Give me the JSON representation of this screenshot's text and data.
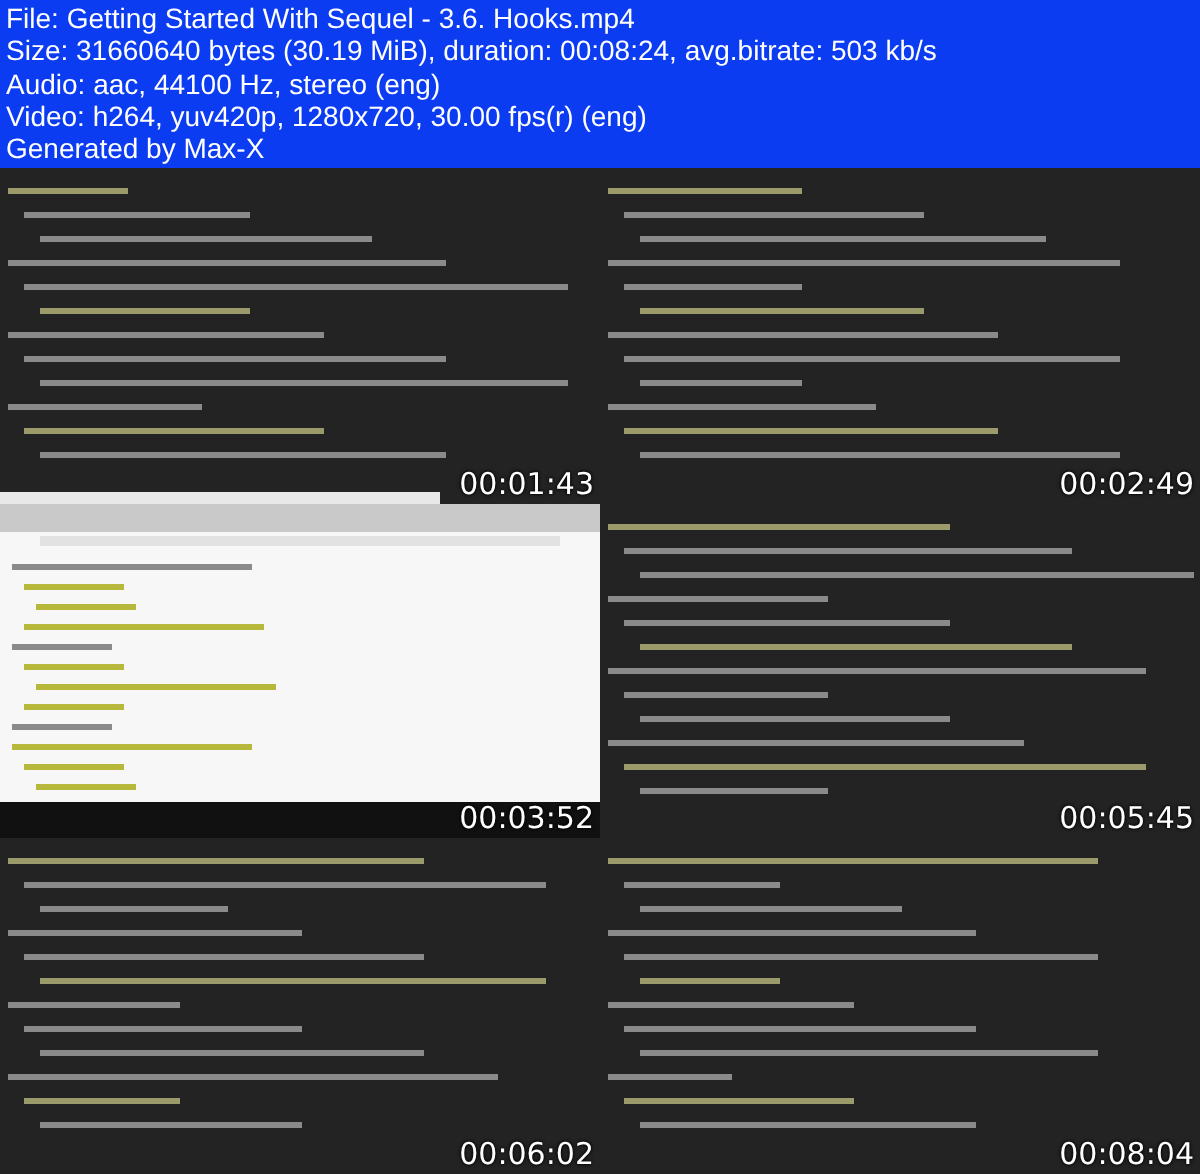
{
  "info_lines": [
    "File: Getting Started With Sequel - 3.6. Hooks.mp4",
    "Size: 31660640 bytes (30.19 MiB), duration: 00:08:24, avg.bitrate: 503 kb/s",
    "Audio: aac, 44100 Hz, stereo (eng)",
    "Video: h264, yuv420p, 1280x720, 30.00 fps(r) (eng)",
    "Generated by Max-X"
  ],
  "frames": [
    {
      "kind": "picture",
      "timestamp": "00:01:43"
    },
    {
      "kind": "picture",
      "timestamp": "00:02:49"
    },
    {
      "kind": "picture",
      "timestamp": "00:03:52"
    },
    {
      "kind": "picture",
      "timestamp": "00:05:45"
    },
    {
      "kind": "picture",
      "timestamp": "00:06:02"
    },
    {
      "kind": "picture",
      "timestamp": "00:08:04"
    }
  ]
}
